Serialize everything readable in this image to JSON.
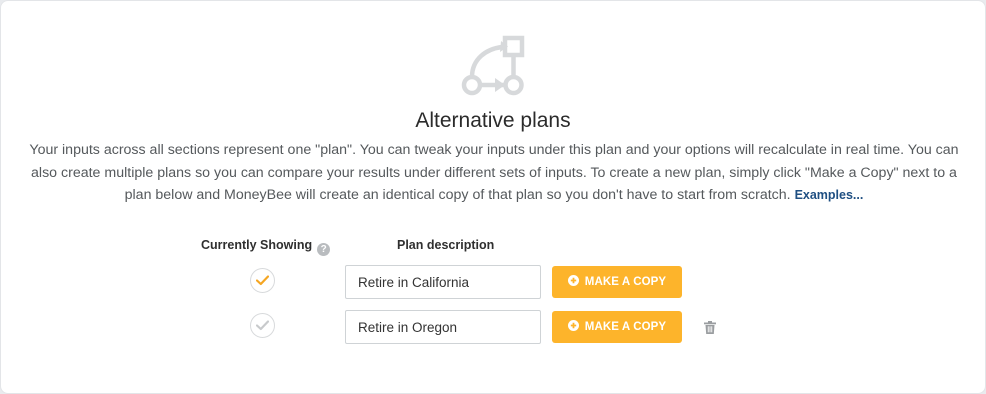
{
  "header": {
    "icon": "workflow-branch-icon",
    "title": "Alternative plans",
    "description": "Your inputs across all sections represent one \"plan\". You can tweak your inputs under this plan and your options will recalculate in real time. You can also create multiple plans so you can compare your results under different sets of inputs. To create a new plan, simply click \"Make a Copy\" next to a plan below and MoneyBee will create an identical copy of that plan so you don't have to start from scratch.",
    "examples_link": "Examples..."
  },
  "table": {
    "col_showing": "Currently Showing",
    "col_showing_help_icon": "question-circle-icon",
    "col_description": "Plan description"
  },
  "plans": [
    {
      "name": "Retire in California",
      "active": true,
      "copy_label": "MAKE A COPY",
      "deletable": false
    },
    {
      "name": "Retire in Oregon",
      "active": false,
      "copy_label": "MAKE A COPY",
      "deletable": true
    }
  ],
  "colors": {
    "accent": "#fdb42b",
    "check_active": "#f5a623",
    "check_inactive": "#c8cacc",
    "link": "#1f4f82",
    "icon_muted": "#d6d8da"
  }
}
